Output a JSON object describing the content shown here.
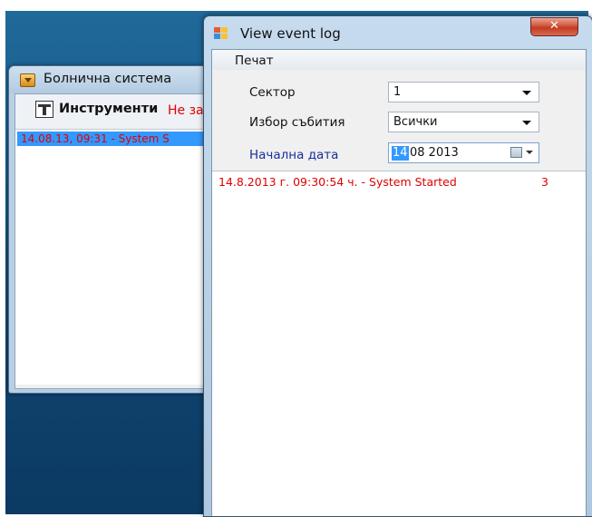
{
  "background_window": {
    "title": "Болнична система",
    "toolbar": {
      "tools_label": "Инструменти",
      "status_text": "Не за"
    },
    "list_items": [
      "14.08.13, 09:31 - System S"
    ]
  },
  "dialog": {
    "title": "View event log",
    "close_glyph": "✕",
    "menu": {
      "print_label": "Печат"
    },
    "form": {
      "sector_label": "Сектор",
      "sector_value": "1",
      "event_label": "Избор събития",
      "event_value": "Всички",
      "start_date_label": "Начална дата",
      "date_day": "14",
      "date_rest": "08 2013"
    },
    "log_entries": [
      {
        "text": "14.8.2013 г. 09:30:54 ч. - System Started",
        "count": "3"
      }
    ]
  },
  "colors": {
    "error_text": "#e00000",
    "selection": "#3399ff",
    "label_blue": "#1a2f9a"
  }
}
